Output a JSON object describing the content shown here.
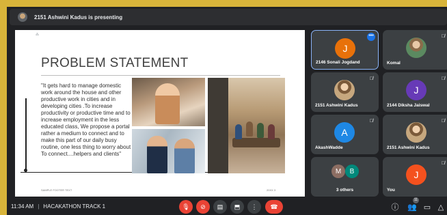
{
  "presenter_bar": {
    "text": "2151 Ashwini Kadus is presenting"
  },
  "slide": {
    "title": "PROBLEM STATEMENT",
    "body": "\"It gets hard to manage domestic work around the house and other productive work in cities and in developing cities .To increase productivity or productive time and to increase employment in the less educated class, We propose a portal rather a medium to connect and to make this part of our daily busy routine, one less thing to worry about To connect....helpers and clients\"",
    "footer_left": "SAMPLE FOOTER TEXT",
    "footer_right": "20XX     3"
  },
  "participants": [
    {
      "name": "2146 Sonali Jogdand",
      "initial": "J",
      "color": "#e8710a",
      "active": true
    },
    {
      "name": "Komal",
      "initial": "",
      "color": "#5b8a60",
      "photo": true
    },
    {
      "name": "2151 Ashwini Kadus",
      "initial": "",
      "color": "#c6a77e",
      "photo": true
    },
    {
      "name": "2144 Diksha Jaiswal",
      "initial": "J",
      "color": "#673ab7"
    },
    {
      "name": "AkashWadde",
      "initial": "A",
      "color": "#1e88e5"
    },
    {
      "name": "2151 Ashwini Kadus",
      "initial": "",
      "color": "#c6a77e",
      "photo": true
    },
    {
      "name": "3 others",
      "initials": [
        "M",
        "B"
      ],
      "colors": [
        "#8d6e63",
        "#00897b"
      ]
    },
    {
      "name": "You",
      "initial": "J",
      "color": "#f4511e"
    }
  ],
  "bottom_bar": {
    "time": "11:34 AM",
    "meeting_name": "HACAKATHON TRACK 1",
    "people_count": "11"
  },
  "colors": {
    "frame": "#d8b43a",
    "background": "#202124",
    "tile": "#3c4043",
    "danger": "#ea4335",
    "accent": "#1a73e8"
  },
  "icons": [
    "mic-off-icon",
    "camera-off-icon",
    "captions-icon",
    "present-icon",
    "more-vert-icon",
    "end-call-icon",
    "info-icon",
    "people-icon",
    "chat-icon",
    "activities-icon"
  ]
}
